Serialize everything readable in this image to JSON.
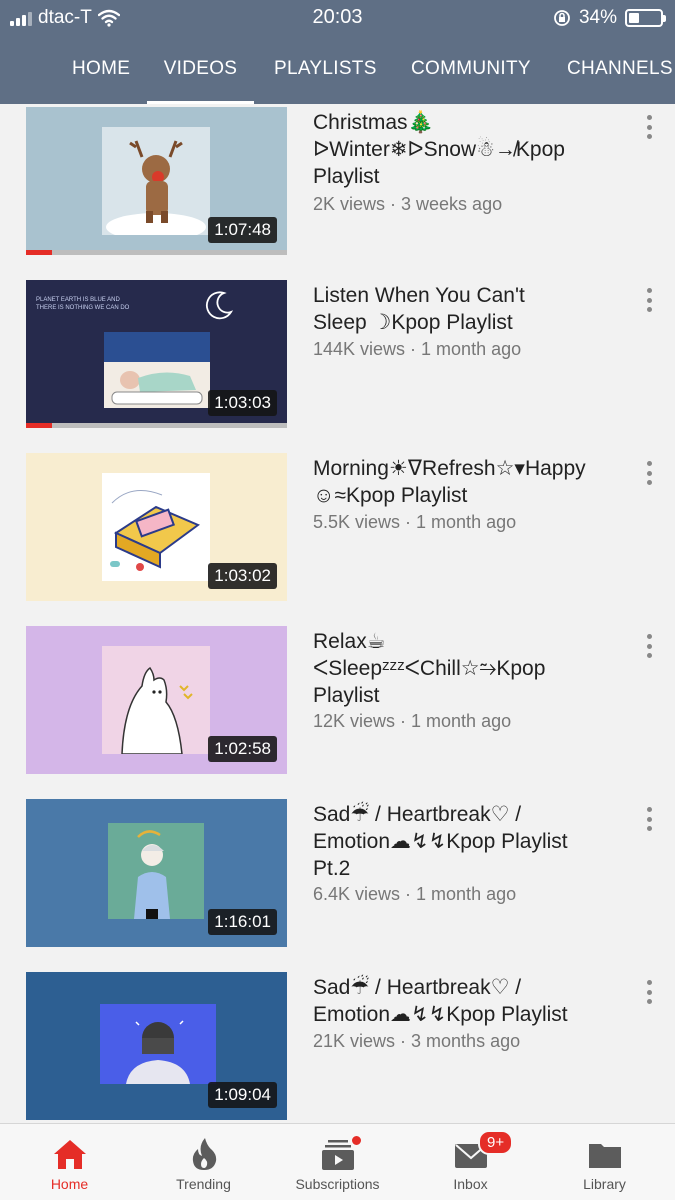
{
  "status": {
    "carrier": "dtac-T",
    "time": "20:03",
    "battery": "34%"
  },
  "tabs": [
    {
      "label": "HOME",
      "active": false
    },
    {
      "label": "VIDEOS",
      "active": true
    },
    {
      "label": "PLAYLISTS",
      "active": false
    },
    {
      "label": "COMMUNITY",
      "active": false
    },
    {
      "label": "CHANNELS",
      "active": false
    }
  ],
  "videos": [
    {
      "title_lines": [
        "Christmas🎄",
        "ᐅWinter❄ᐅSnow☃↛Kpop",
        "Playlist"
      ],
      "meta": "2K views · 3 weeks ago",
      "duration": "1:07:48",
      "bg": "#a9c2cf",
      "watched": 0.1
    },
    {
      "title_lines": [
        "Listen When You Can't",
        "Sleep ☽Kpop Playlist"
      ],
      "meta": "144K views · 1 month ago",
      "duration": "1:03:03",
      "bg": "#262a4c",
      "watched": 0.1,
      "art_text": "PLANET EARTH IS BLUE AND THERE IS NOTHING WE CAN DO"
    },
    {
      "title_lines": [
        "Morning☀ᐁRefresh☆▾Happy",
        "☺≈Kpop Playlist"
      ],
      "meta": "5.5K views · 1 month ago",
      "duration": "1:03:02",
      "bg": "#f8edd0",
      "watched": 0
    },
    {
      "title_lines": [
        "Relax☕",
        "ᐸSleepᶻᶻᶻᐸChill☆⥲Kpop",
        "Playlist"
      ],
      "meta": "12K views · 1 month ago",
      "duration": "1:02:58",
      "bg": "#d4b6e8",
      "watched": 0
    },
    {
      "title_lines": [
        "Sad☔ / Heartbreak♡ /",
        "Emotion☁↯↯Kpop Playlist",
        "Pt.2"
      ],
      "meta": "6.4K views · 1 month ago",
      "duration": "1:16:01",
      "bg": "#4a79a8",
      "watched": 0
    },
    {
      "title_lines": [
        "Sad☔ / Heartbreak♡ /",
        "Emotion☁↯↯Kpop Playlist"
      ],
      "meta": "21K views · 3 months ago",
      "duration": "1:09:04",
      "bg": "#2d5f92",
      "watched": 0
    }
  ],
  "bottom_nav": [
    {
      "label": "Home",
      "icon": "home-icon",
      "active": true
    },
    {
      "label": "Trending",
      "icon": "flame-icon",
      "active": false
    },
    {
      "label": "Subscriptions",
      "icon": "subscriptions-icon",
      "active": false
    },
    {
      "label": "Inbox",
      "icon": "inbox-icon",
      "active": false,
      "badge": "9+"
    },
    {
      "label": "Library",
      "icon": "folder-icon",
      "active": false
    }
  ],
  "colors": {
    "header": "#5f6f85",
    "accent": "#e52d27",
    "background": "#f2f2f2"
  }
}
